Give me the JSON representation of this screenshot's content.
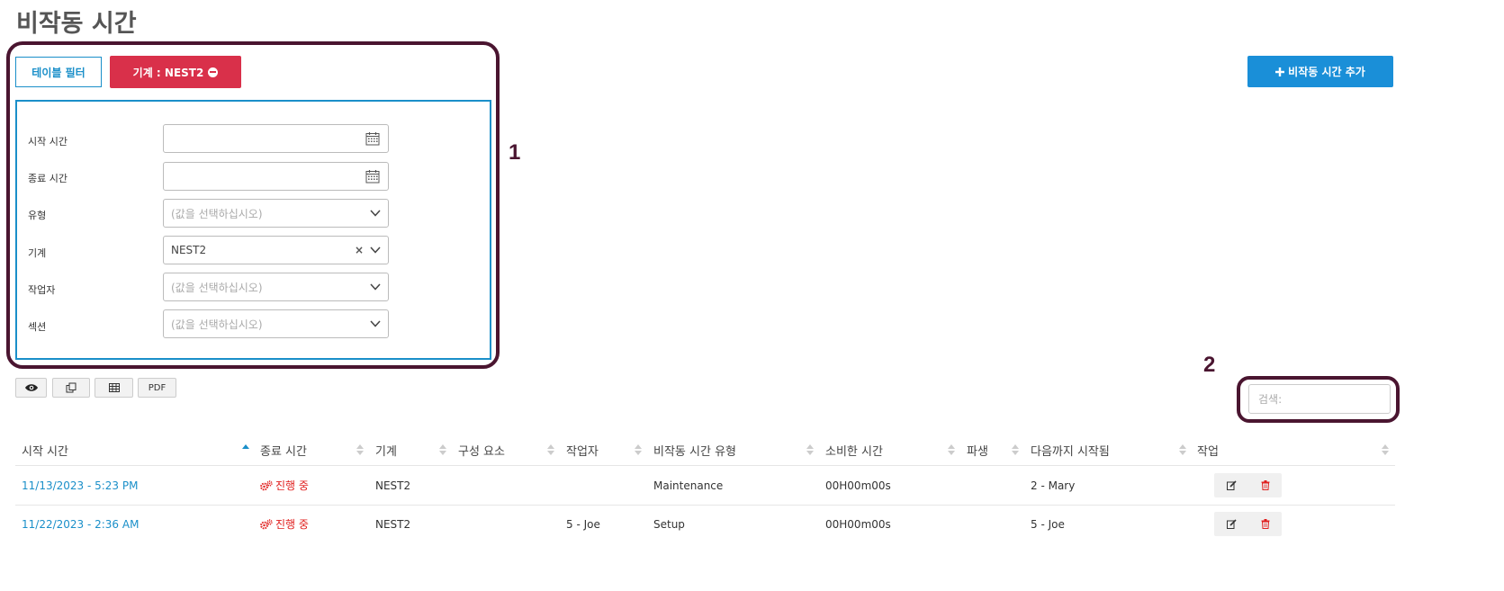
{
  "page": {
    "title": "비작동 시간"
  },
  "filter": {
    "table_filter_label": "테이블 필터",
    "chip_label": "기계 : NEST2",
    "fields": [
      {
        "label": "시작 시간",
        "value": "",
        "placeholder": ""
      },
      {
        "label": "종료 시간",
        "value": "",
        "placeholder": ""
      },
      {
        "label": "유형",
        "value": "",
        "placeholder": "(값을 선택하십시오)"
      },
      {
        "label": "기계",
        "value": "NEST2",
        "placeholder": "",
        "clear": "×"
      },
      {
        "label": "작업자",
        "value": "",
        "placeholder": "(값을 선택하십시오)"
      },
      {
        "label": "섹션",
        "value": "",
        "placeholder": "(값을 선택하십시오)"
      }
    ]
  },
  "add_button": {
    "label": "비작동 시간 추가",
    "icon": "plus-icon"
  },
  "annotations": {
    "one": "1",
    "two": "2"
  },
  "toolbar": {
    "buttons": [
      {
        "name": "eye-icon"
      },
      {
        "name": "copy-icon"
      },
      {
        "name": "table-icon"
      },
      {
        "label": "PDF"
      }
    ]
  },
  "search": {
    "placeholder": "검색:"
  },
  "table": {
    "columns": [
      "시작 시간",
      "종료 시간",
      "기계",
      "구성 요소",
      "작업자",
      "비작동 시간 유형",
      "소비한 시간",
      "파생",
      "다음까지 시작됨",
      "작업"
    ],
    "rows": [
      {
        "start": "11/13/2023 - 5:23 PM",
        "end": "진행 중",
        "machine": "NEST2",
        "component": "",
        "operator": "",
        "type": "Maintenance",
        "spent": "00H00m00s",
        "derived": "",
        "started_until": "2 - Mary"
      },
      {
        "start": "11/22/2023 - 2:36 AM",
        "end": "진행 중",
        "machine": "NEST2",
        "component": "",
        "operator": "5 - Joe",
        "type": "Setup",
        "spent": "00H00m00s",
        "derived": "",
        "started_until": "5 - Joe"
      }
    ]
  },
  "colors": {
    "accent_blue": "#1a8fc9",
    "chip_red": "#d9304a",
    "annotation": "#4a1530",
    "in_progress_red": "#e0201f"
  }
}
